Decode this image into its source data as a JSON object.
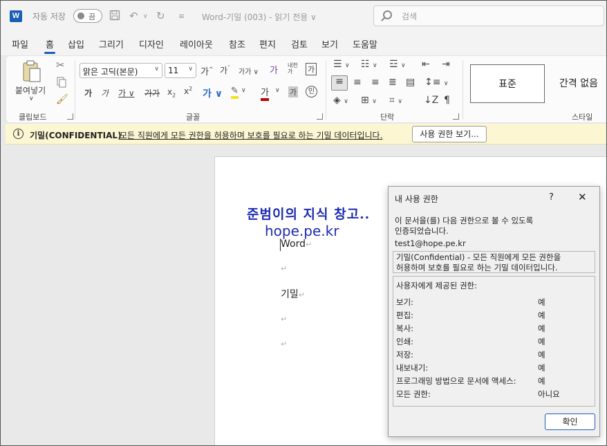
{
  "titlebar": {
    "autosave_label": "자동 저장",
    "autosave_state": "끔",
    "doc_title": "Word-기밀 (003)  -  읽기 전용 ∨",
    "search_placeholder": "검색"
  },
  "tabs": [
    "파일",
    "홈",
    "삽입",
    "그리기",
    "디자인",
    "레이아웃",
    "참조",
    "편지",
    "검토",
    "보기",
    "도움말"
  ],
  "active_tab": "홈",
  "ribbon": {
    "clipboard": {
      "paste_label": "붙여넣기",
      "group_label": "클립보드"
    },
    "font": {
      "font_name": "맑은 고딕(본문)",
      "font_size": "11",
      "group_label": "글꼴"
    },
    "paragraph": {
      "group_label": "단락"
    },
    "styles": {
      "normal": "표준",
      "no_spacing": "간격 없음",
      "group_label": "스타일"
    }
  },
  "infobar": {
    "title": "기밀(CONFIDENTIAL)",
    "message": "모든 직원에게 모든 권한을 허용하며 보호를 필요로 하는 기밀 데이터입니다.",
    "button": "사용 권한 보기..."
  },
  "document": {
    "watermark_line1": "준범이의 지식 창고..",
    "watermark_line2": "hope.pe.kr",
    "paragraphs": [
      "Word",
      "",
      "기밀",
      "",
      ""
    ]
  },
  "dialog": {
    "title": "내 사용 권한",
    "help": "?",
    "intro_line1": "이 문서을(를) 다음 권한으로 볼 수 있도록",
    "intro_line2": "인증되었습니다.",
    "user": "test1@hope.pe.kr",
    "description_line1": "기밀(Confidential) - 모든 직원에게 모든 권한을",
    "description_line2": "허용하며 보호를 필요로 하는 기밀 데이터입니다.",
    "rights_header": "사용자에게 제공된 권한:",
    "rights": [
      {
        "name": "보기:",
        "value": "예"
      },
      {
        "name": "편집:",
        "value": "예"
      },
      {
        "name": "복사:",
        "value": "예"
      },
      {
        "name": "인쇄:",
        "value": "예"
      },
      {
        "name": "저장:",
        "value": "예"
      },
      {
        "name": "내보내기:",
        "value": "예"
      },
      {
        "name": "프로그래밍 방법으로 문서에 액세스:",
        "value": "예"
      },
      {
        "name": "모든 권한:",
        "value": "아니요"
      }
    ],
    "ok_button": "확인"
  },
  "colors": {
    "accent": "#1b5eb8",
    "infobar_bg": "#fcf7d2",
    "watermark": "#1d2bb0"
  }
}
